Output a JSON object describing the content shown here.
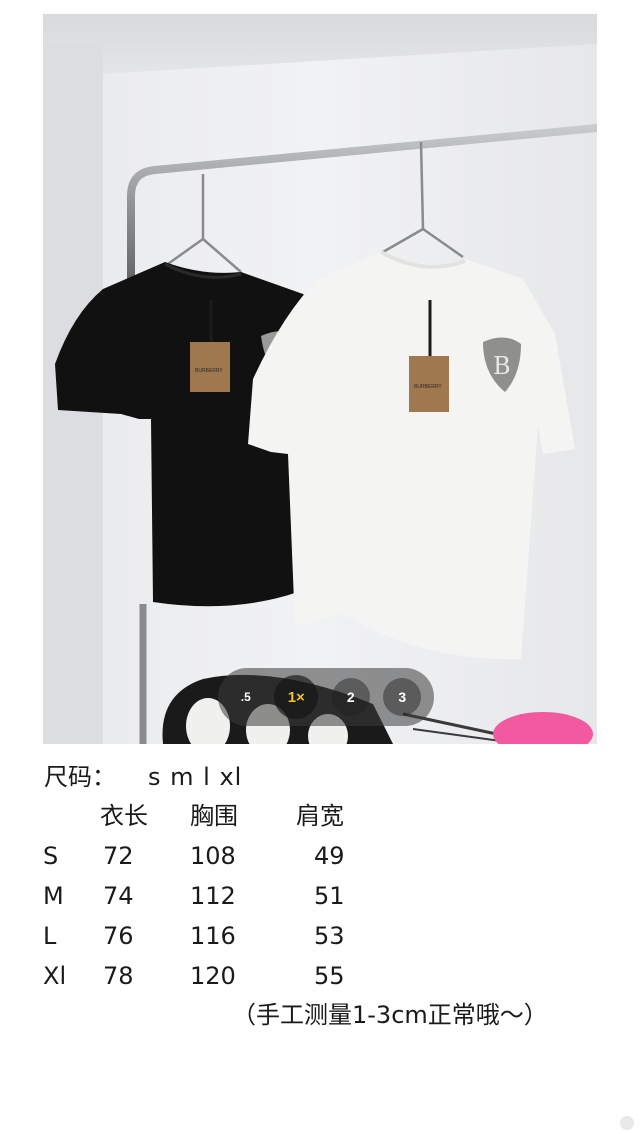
{
  "zoom": {
    "options": [
      ".5",
      "1×",
      "2",
      "3"
    ],
    "active_index": 1
  },
  "tags": {
    "brand": "BURBERRY"
  },
  "size_info": {
    "sizes_label": "尺码：",
    "sizes_value": "s m l xl",
    "headers": [
      "衣长",
      "胸围",
      "肩宽"
    ],
    "rows": [
      {
        "size": "S",
        "length": "72",
        "chest": "108",
        "shoulder": "49"
      },
      {
        "size": "M",
        "length": "74",
        "chest": "112",
        "shoulder": "51"
      },
      {
        "size": "L",
        "length": "76",
        "chest": "116",
        "shoulder": "53"
      },
      {
        "size": "Xl",
        "length": "78",
        "chest": "120",
        "shoulder": "55"
      }
    ],
    "note": "（手工测量1-3cm正常哦～）"
  },
  "colors": {
    "shirt_black": "#111111",
    "shirt_white": "#f4f4f2",
    "tag_brown": "#a07850",
    "zoom_active": "#f5c518"
  }
}
